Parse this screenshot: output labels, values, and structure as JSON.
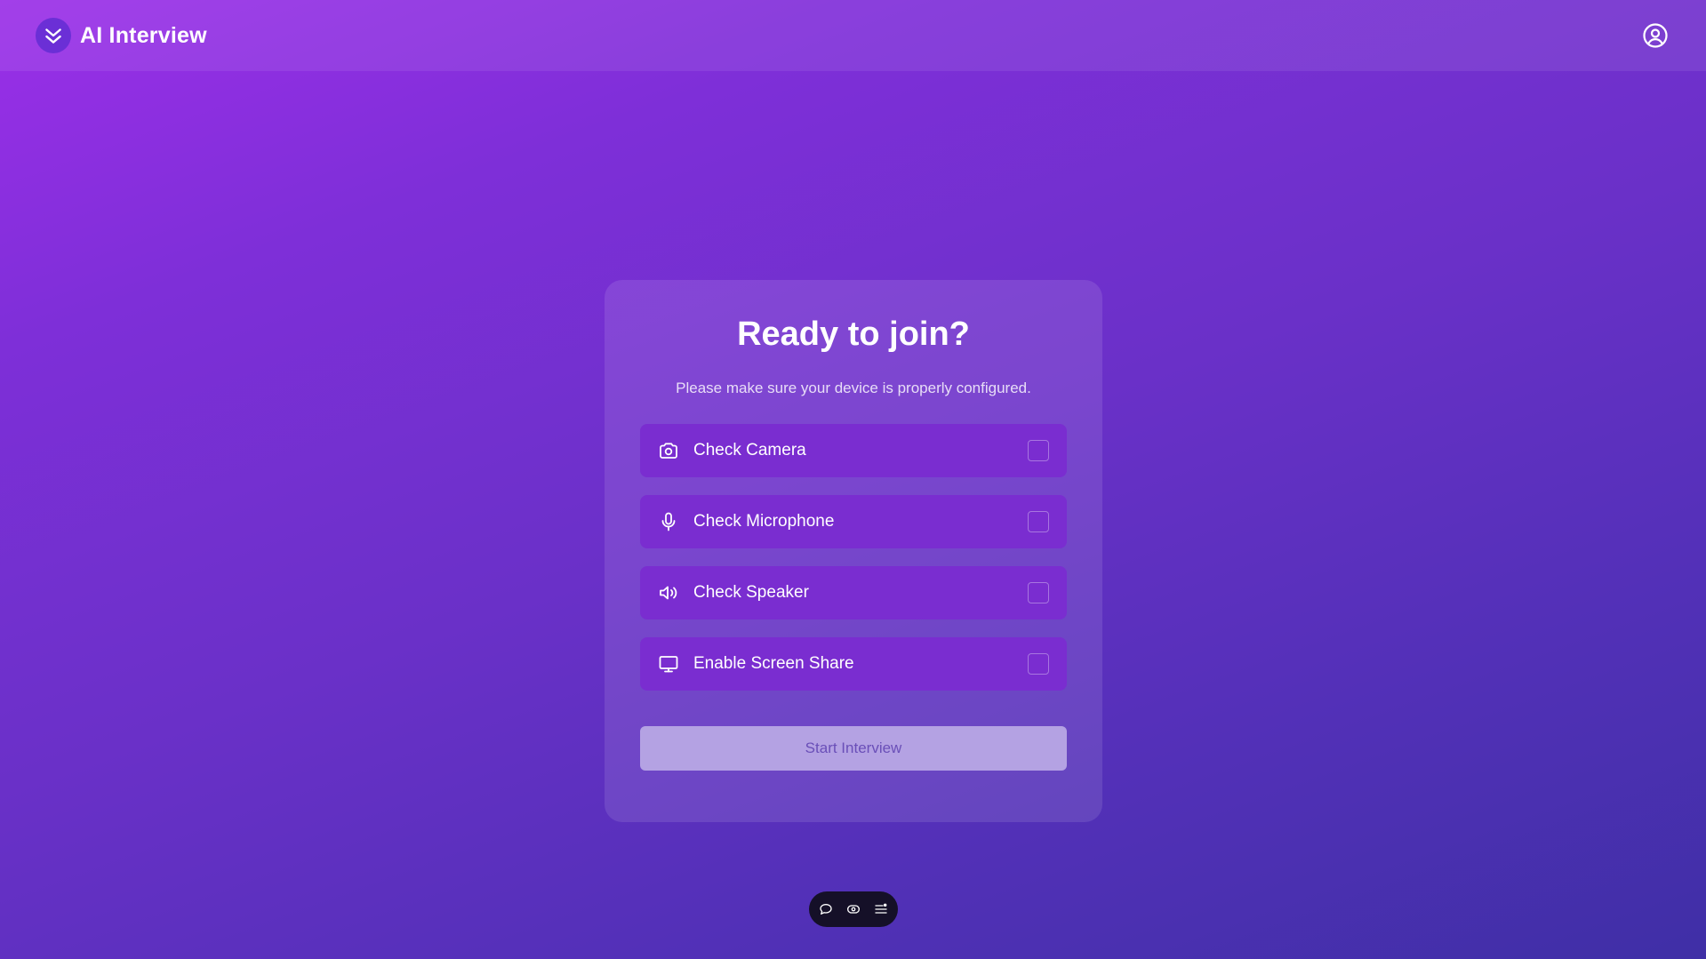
{
  "header": {
    "app_title": "AI Interview",
    "logo_icon": "double-chevron-down-icon",
    "profile_icon": "user-circle-icon"
  },
  "card": {
    "title": "Ready to join?",
    "subtitle": "Please make sure your device is properly configured.",
    "checks": [
      {
        "label": "Check Camera",
        "icon": "camera-icon",
        "checked": false
      },
      {
        "label": "Check Microphone",
        "icon": "microphone-icon",
        "checked": false
      },
      {
        "label": "Check Speaker",
        "icon": "speaker-icon",
        "checked": false
      },
      {
        "label": "Enable Screen Share",
        "icon": "monitor-icon",
        "checked": false
      }
    ],
    "start_button_label": "Start Interview",
    "start_button_enabled": false
  },
  "toolbar": {
    "items": [
      {
        "icon": "chat-bubble-icon"
      },
      {
        "icon": "record-toggle-icon"
      },
      {
        "icon": "list-settings-icon"
      }
    ]
  },
  "colors": {
    "background_start": "#9b2fe8",
    "background_end": "#3f2fa6",
    "check_row": "#7a2dd0",
    "start_button": "#b4a2e3",
    "toolbar": "#151028"
  }
}
